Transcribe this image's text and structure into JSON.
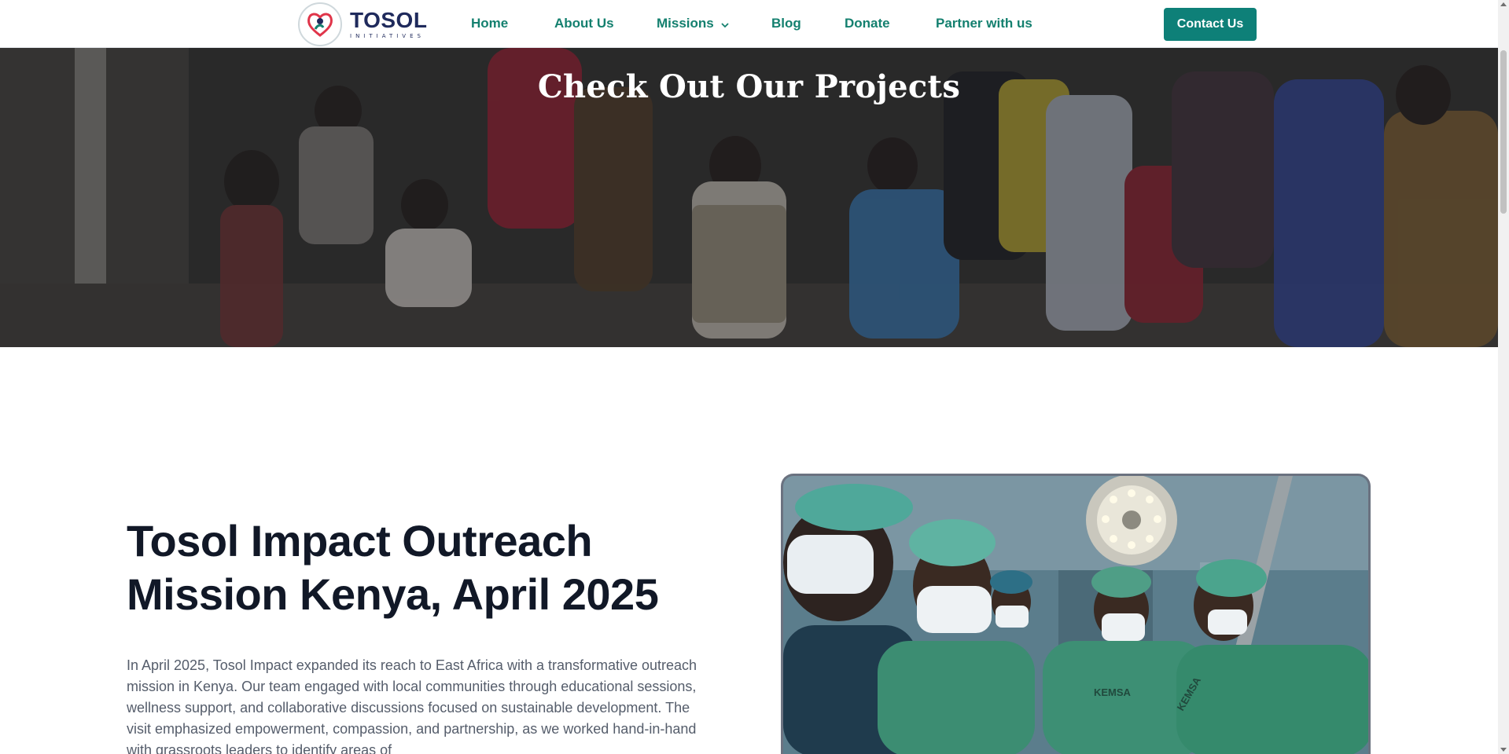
{
  "header": {
    "logo_name": "TOSOL",
    "logo_sub": "INITIATIVES",
    "nav": [
      {
        "label": "Home"
      },
      {
        "label": "About Us"
      },
      {
        "label": "Missions"
      },
      {
        "label": "Blog"
      },
      {
        "label": "Donate"
      },
      {
        "label": "Partner with us"
      }
    ],
    "contact_label": "Contact Us"
  },
  "hero": {
    "title": "Check Out Our Projects"
  },
  "mission": {
    "title": "Tosol Impact Outreach Mission Kenya, April 2025",
    "body": "In April 2025, Tosol Impact expanded its reach to East Africa with a transformative outreach mission in Kenya. Our team engaged with local communities through educational sessions, wellness support, and collaborative discussions focused on sustainable development. The visit emphasized empowerment, compassion, and partnership, as we worked hand-in-hand with grassroots leaders to identify areas of"
  },
  "photo": {
    "label_1": "KEMSA",
    "label_2": "KEMSA"
  },
  "colors": {
    "brand_teal": "#0e8078",
    "nav_text": "#14806f",
    "logo_navy": "#1f2a5c",
    "heading": "#111827",
    "body_text": "#555d6b"
  },
  "icons": [
    "heart-logo-icon",
    "chevron-down-icon"
  ]
}
